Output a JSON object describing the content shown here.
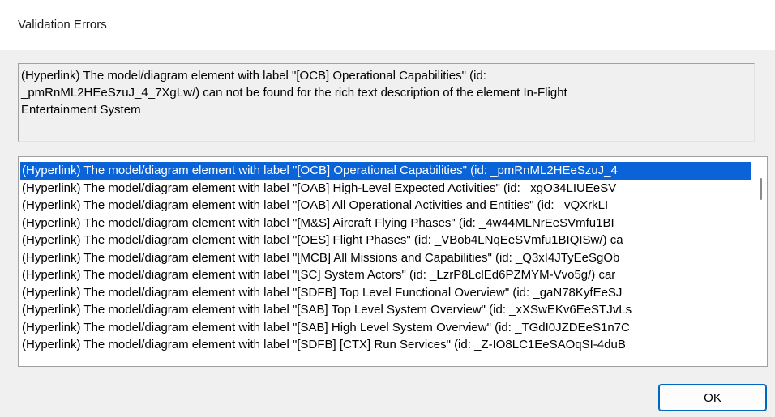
{
  "window": {
    "title": "Validation Errors"
  },
  "detail": {
    "text": "(Hyperlink) The model/diagram element with label \"[OCB] Operational Capabilities\" (id:\n_pmRnML2HEeSzuJ_4_7XgLw/) can not be found for the rich text description of the element In-Flight\nEntertainment System"
  },
  "error_list": {
    "items": [
      "(Hyperlink) The model/diagram element with label \"[OCB] Operational Capabilities\" (id: _pmRnML2HEeSzuJ_4",
      "(Hyperlink) The model/diagram element with label \"[OAB] High-Level Expected Activities\" (id: _xgO34LIUEeSV",
      "(Hyperlink) The model/diagram element with label \"[OAB] All Operational Activities and Entities\" (id: _vQXrkLI",
      "(Hyperlink) The model/diagram element with label \"[M&S] Aircraft Flying Phases\" (id: _4w44MLNrEeSVmfu1BI",
      "(Hyperlink) The model/diagram element with label \"[OES] Flight Phases\" (id: _VBob4LNqEeSVmfu1BIQISw/) ca",
      "(Hyperlink) The model/diagram element with label \"[MCB] All Missions and Capabilities\" (id: _Q3xI4JTyEeSgOb",
      "(Hyperlink) The model/diagram element with label \"[SC] System Actors\" (id: _LzrP8LclEd6PZMYM-Vvo5g/) car",
      "(Hyperlink) The model/diagram element with label \"[SDFB] Top Level Functional Overview\" (id: _gaN78KyfEeSJ",
      "(Hyperlink) The model/diagram element with label \"[SAB] Top Level System Overview\" (id: _xXSwEKv6EeSTJvLs",
      "(Hyperlink) The model/diagram element with label \"[SAB] High Level System Overview\" (id: _TGdI0JZDEeS1n7C",
      "(Hyperlink) The model/diagram element with label \"[SDFB] [CTX] Run Services\" (id: _Z-IO8LC1EeSAOqSI-4duB"
    ],
    "selected_index": 0
  },
  "buttons": {
    "ok_label": "OK"
  },
  "colors": {
    "selection": "#0a64d8",
    "button_border": "#0067c0"
  }
}
